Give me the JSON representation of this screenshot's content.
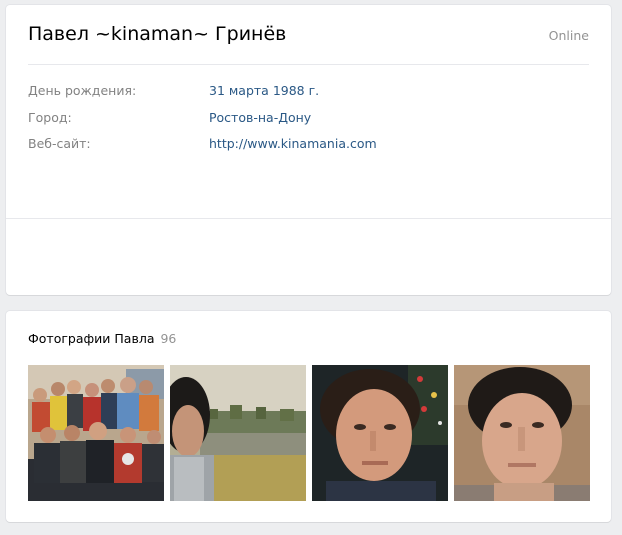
{
  "profile": {
    "name": "Павел ~kinaman~ Гринёв",
    "status": "Online",
    "info": [
      {
        "label": "День рождения:",
        "value": "31 марта 1988 г."
      },
      {
        "label": "Город:",
        "value": "Ростов-на-Дону"
      },
      {
        "label": "Веб-сайт:",
        "value": "http://www.kinamania.com"
      }
    ]
  },
  "photos": {
    "title": "Фотографии Павла",
    "count": "96",
    "items": [
      {
        "subject": "group-photo"
      },
      {
        "subject": "lake-portrait"
      },
      {
        "subject": "christmas-portrait"
      },
      {
        "subject": "selfie-portrait"
      }
    ]
  },
  "colors": {
    "background": "#edeef0",
    "card": "#ffffff",
    "link": "#2a5885",
    "muted": "#828282",
    "status": "#939393"
  }
}
